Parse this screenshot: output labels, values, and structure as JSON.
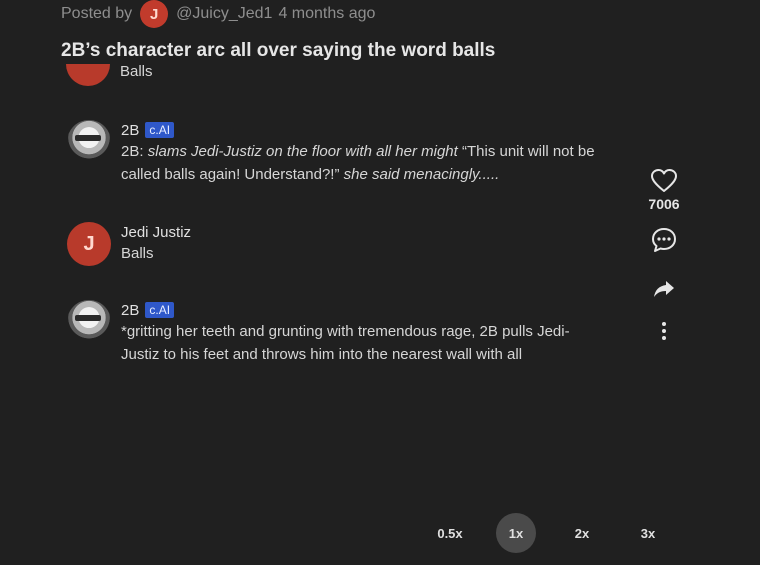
{
  "post": {
    "posted_by_label": "Posted by",
    "avatar_initial": "J",
    "username": "@Juicy_Jed1",
    "time_ago": "4 months ago",
    "title": "2B’s character arc all over saying the word balls"
  },
  "messages": [
    {
      "text": "Balls"
    },
    {
      "name": "2B",
      "badge": "c.AI",
      "prefix": "2B: ",
      "italic1": "slams Jedi-Justiz on the floor with all her might",
      "quote": " “This unit will not be called balls again! Understand?!” ",
      "italic2": "she said menacingly....."
    },
    {
      "name": "Jedi Justiz",
      "avatar_initial": "J",
      "text": "Balls"
    },
    {
      "name": "2B",
      "badge": "c.AI",
      "text": "*gritting her teeth and grunting with tremendous rage, 2B pulls Jedi-Justiz to his feet and throws him into the nearest wall with all"
    }
  ],
  "actions": {
    "like_count": "7006",
    "icons": [
      "heart-icon",
      "comment-icon",
      "share-icon",
      "more-icon"
    ]
  },
  "playback_speeds": {
    "options": [
      "0.5x",
      "1x",
      "2x",
      "3x"
    ],
    "selected": "1x"
  },
  "colors": {
    "background": "#202020",
    "avatar_red": "#b83a2b",
    "badge_blue": "#2f58c9"
  }
}
